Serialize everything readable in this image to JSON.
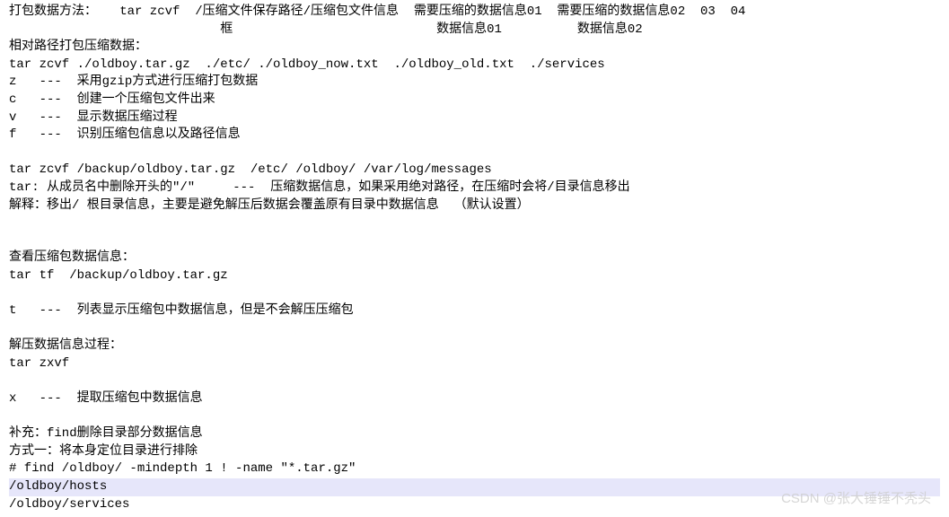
{
  "lines": {
    "l1": "打包数据方法：   tar zcvf  /压缩文件保存路径/压缩包文件信息  需要压缩的数据信息01  需要压缩的数据信息02  03  04",
    "l2": "                            框                           数据信息01          数据信息02",
    "l3": "相对路径打包压缩数据：",
    "l4": "tar zcvf ./oldboy.tar.gz  ./etc/ ./oldboy_now.txt  ./oldboy_old.txt  ./services",
    "l5": "z   ---  采用gzip方式进行压缩打包数据",
    "l6": "c   ---  创建一个压缩包文件出来",
    "l7": "v   ---  显示数据压缩过程",
    "l8": "f   ---  识别压缩包信息以及路径信息",
    "l9": " ",
    "l10": "tar zcvf /backup/oldboy.tar.gz  /etc/ /oldboy/ /var/log/messages",
    "l11": "tar: 从成员名中删除开头的\"/\"     ---  压缩数据信息，如果采用绝对路径，在压缩时会将/目录信息移出",
    "l12": "解释：移出/ 根目录信息，主要是避免解压后数据会覆盖原有目录中数据信息  （默认设置）",
    "l13": " ",
    "l14": " ",
    "l15": "查看压缩包数据信息：",
    "l16": "tar tf  /backup/oldboy.tar.gz",
    "l17": " ",
    "l18": "t   ---  列表显示压缩包中数据信息，但是不会解压压缩包",
    "l19": " ",
    "l20": "解压数据信息过程：",
    "l21": "tar zxvf ",
    "l22": " ",
    "l23": "x   ---  提取压缩包中数据信息",
    "l24": " ",
    "l25": "补充：find删除目录部分数据信息",
    "l26": "方式一：将本身定位目录进行排除",
    "l27": "# find /oldboy/ -mindepth 1 ! -name \"*.tar.gz\"",
    "l28": "/oldboy/hosts",
    "l29": "/oldboy/services"
  },
  "watermark": "CSDN @张大锤锤不秃头"
}
